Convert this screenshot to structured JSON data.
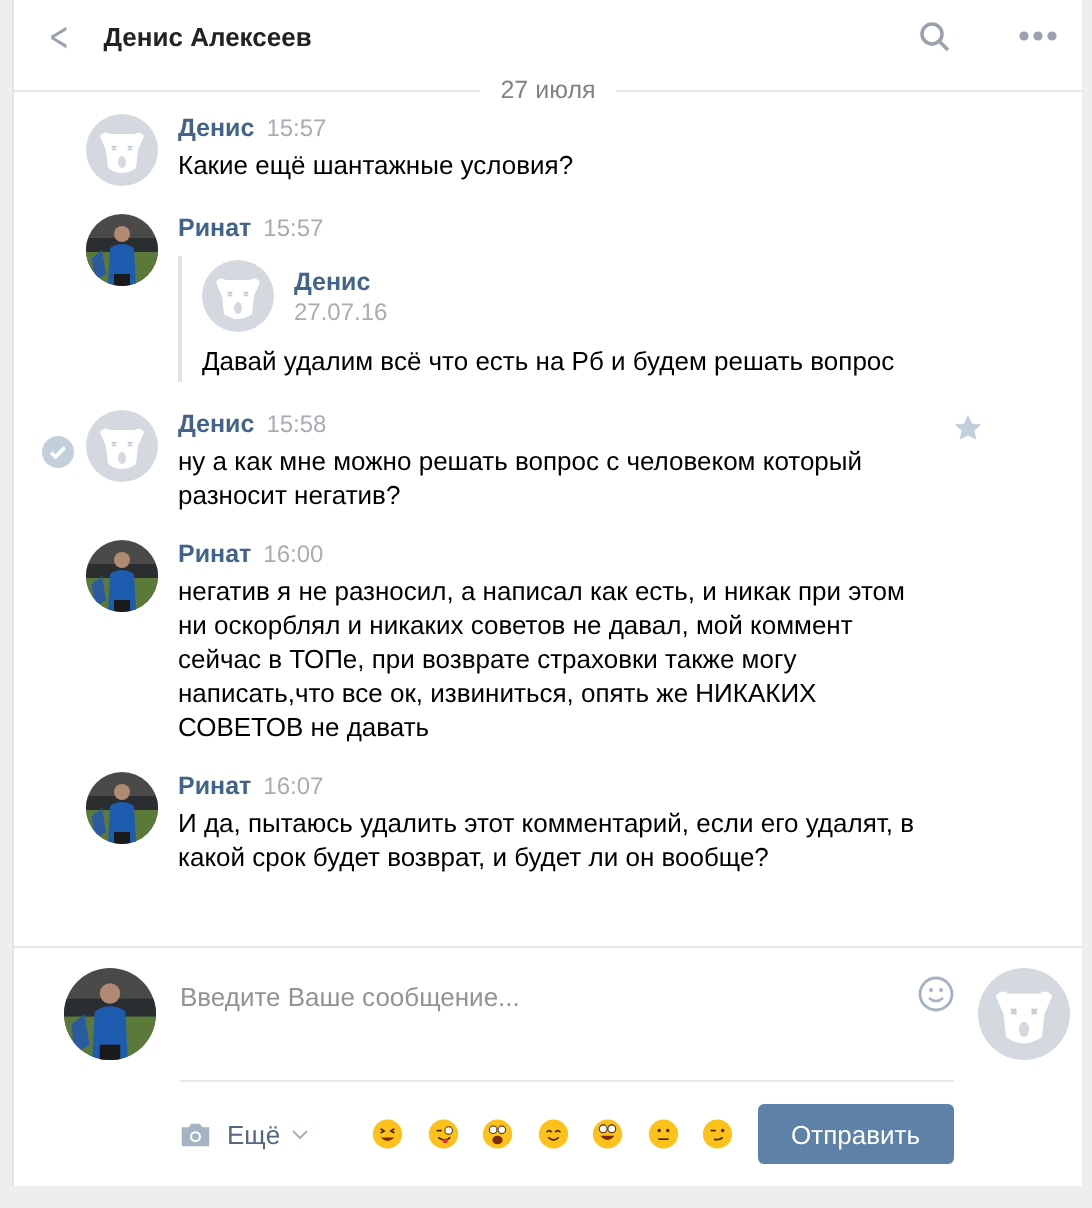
{
  "header": {
    "back": "<",
    "title": "Денис Алексеев"
  },
  "date": "27 июля",
  "messages": [
    {
      "author": "Денис",
      "time": "15:57",
      "avatar": {
        "kind": "placeholder"
      },
      "highlighted": false,
      "text": "Какие ещё шантажные условия?"
    },
    {
      "author": "Ринат",
      "time": "15:57",
      "highlighted": false,
      "forward": {
        "author": "Денис",
        "date": "27.07.16",
        "avatar": {
          "kind": "placeholder"
        },
        "text": "Давай удалим всё что есть на Рб и будем решать вопрос"
      }
    },
    {
      "author": "Денис",
      "time": "15:58",
      "avatar": {
        "kind": "placeholder"
      },
      "highlighted": true,
      "text": "ну а как мне можно решать вопрос с человеком который разносит негатив?"
    },
    {
      "author": "Ринат",
      "time": "16:00",
      "highlighted": false,
      "text": "негатив я не разносил, а написал как есть, и никак при этом ни оскорблял и никаких советов не давал, мой коммент сейчас в ТОПе, при возврате страховки также могу написать,что все ок, извиниться, опять же НИКАКИХ СОВЕТОВ не давать"
    },
    {
      "author": "Ринат",
      "time": "16:07",
      "highlighted": false,
      "text": "И да, пытаюсь удалить этот комментарий, если его удалят, в какой срок будет возврат, и будет ли он вообще?"
    }
  ],
  "composer": {
    "placeholder": "Введите Ваше сообщение...",
    "peer_avatar": {
      "kind": "placeholder"
    },
    "more": "Ещё",
    "send": "Отправить"
  }
}
